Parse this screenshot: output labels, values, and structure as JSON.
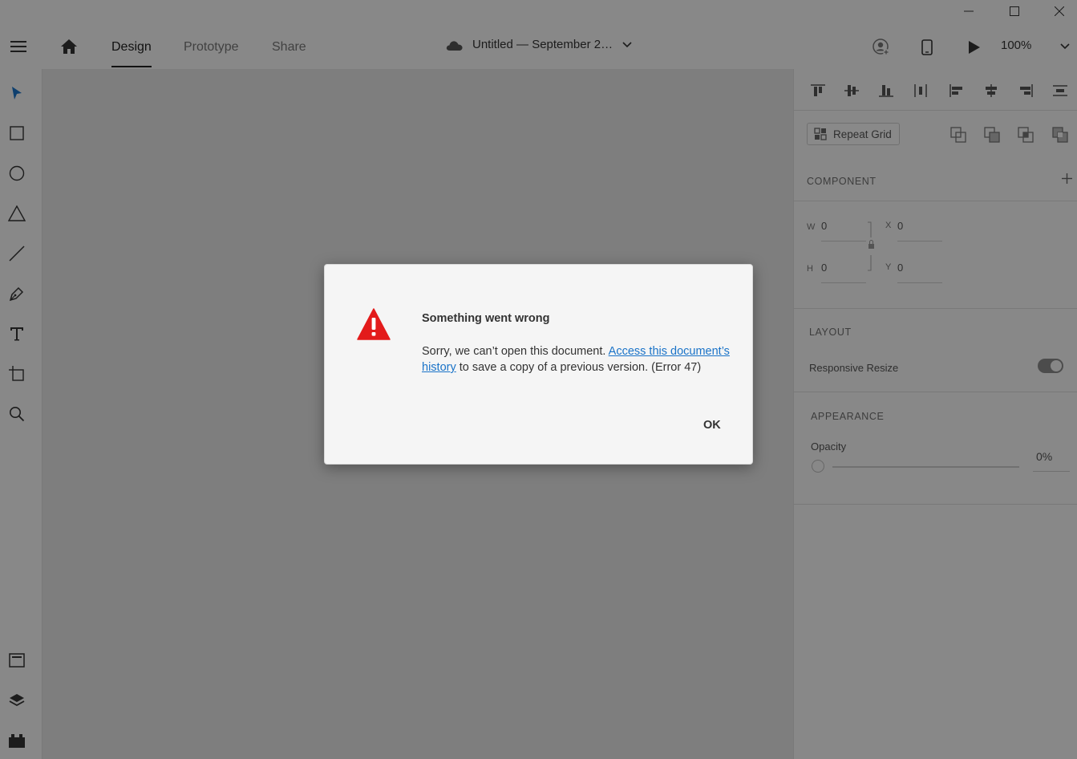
{
  "app": {
    "tabs": [
      {
        "label": "Design",
        "active": true
      },
      {
        "label": "Prototype",
        "active": false
      },
      {
        "label": "Share",
        "active": false
      }
    ],
    "document_title": "Untitled — September 2…",
    "zoom": "100%"
  },
  "right_panel": {
    "repeat_grid_label": "Repeat Grid",
    "component_heading": "COMPONENT",
    "w_label": "W",
    "w_value": "0",
    "h_label": "H",
    "h_value": "0",
    "x_label": "X",
    "x_value": "0",
    "y_label": "Y",
    "y_value": "0",
    "layout_heading": "LAYOUT",
    "responsive_resize_label": "Responsive Resize",
    "responsive_resize_on": true,
    "appearance_heading": "APPEARANCE",
    "opacity_label": "Opacity",
    "opacity_value": "0%"
  },
  "dialog": {
    "title": "Something went wrong",
    "message_before": "Sorry, we can’t open this document. ",
    "link_text": "Access this document’s history",
    "message_after": " to save a copy of a previous version. (Error 47)",
    "ok_label": "OK"
  },
  "colors": {
    "error_icon": "#e31b1b",
    "link": "#1a73c8",
    "overlay": "#000000"
  }
}
